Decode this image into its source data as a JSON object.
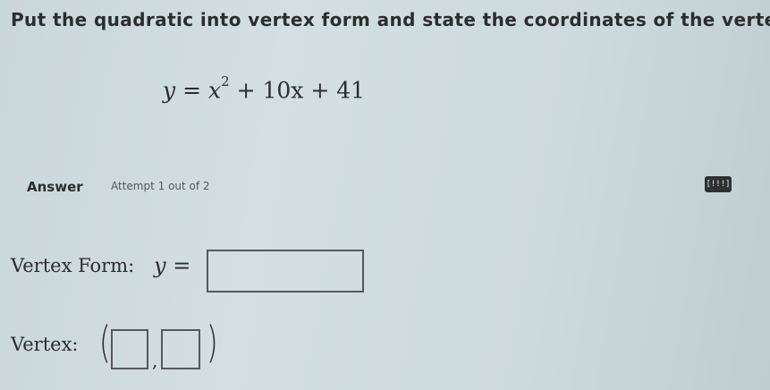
{
  "question": {
    "prompt": "Put the quadratic into vertex form and state the coordinates of the vertex."
  },
  "equation": {
    "lhs": "y",
    "equals": "=",
    "x_var": "x",
    "exponent": "2",
    "rest": "+ 10x + 41"
  },
  "answer": {
    "label": "Answer",
    "attempt_text": "Attempt 1 out of 2",
    "keypad_glyph": "[!!!]"
  },
  "vertex_form": {
    "label": "Vertex Form:",
    "lhs": "y",
    "equals": "=",
    "input_value": ""
  },
  "vertex": {
    "label": "Vertex:",
    "open_paren": "(",
    "comma": ",",
    "close_paren": ")",
    "x_value": "",
    "y_value": ""
  }
}
